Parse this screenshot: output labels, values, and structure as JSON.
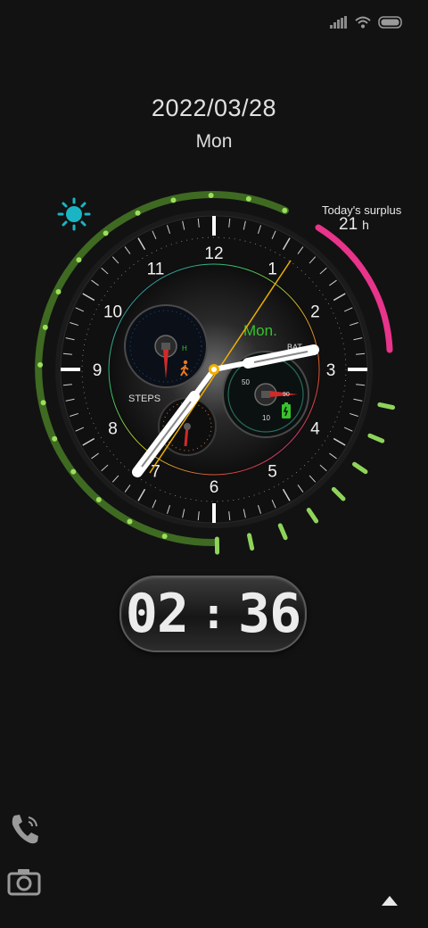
{
  "status_bar": {
    "signal_icon": "signal-icon",
    "wifi_icon": "wifi-icon",
    "battery_icon": "battery-icon"
  },
  "lockscreen": {
    "date": "2022/03/28",
    "day": "Mon",
    "surplus": {
      "label": "Today's surplus",
      "value": "21",
      "unit": "h"
    },
    "weather_icon": "sun-icon",
    "clock": {
      "hours": "02",
      "separator": ":",
      "minutes": "36"
    }
  },
  "watch_face": {
    "dial_numbers": [
      "12",
      "1",
      "2",
      "3",
      "4",
      "5",
      "6",
      "7",
      "8",
      "9",
      "10",
      "11"
    ],
    "day_label": "Mon.",
    "steps_label": "STEPS",
    "battery_label": "BAT",
    "battery_scale": [
      "50",
      "10"
    ],
    "battery_end": "90",
    "step_sub_letter": "H"
  },
  "shortcuts": {
    "phone_icon": "phone-icon",
    "camera_icon": "camera-icon",
    "up_icon": "chevron-up-icon"
  },
  "colors": {
    "green_arc": "#6aa838",
    "pink_arc": "#e8348a",
    "lime_ticks": "#8fd45a",
    "mon_text": "#37c22b",
    "cyan_sun": "#1ab5c4",
    "second_hand": "#f0b000"
  }
}
